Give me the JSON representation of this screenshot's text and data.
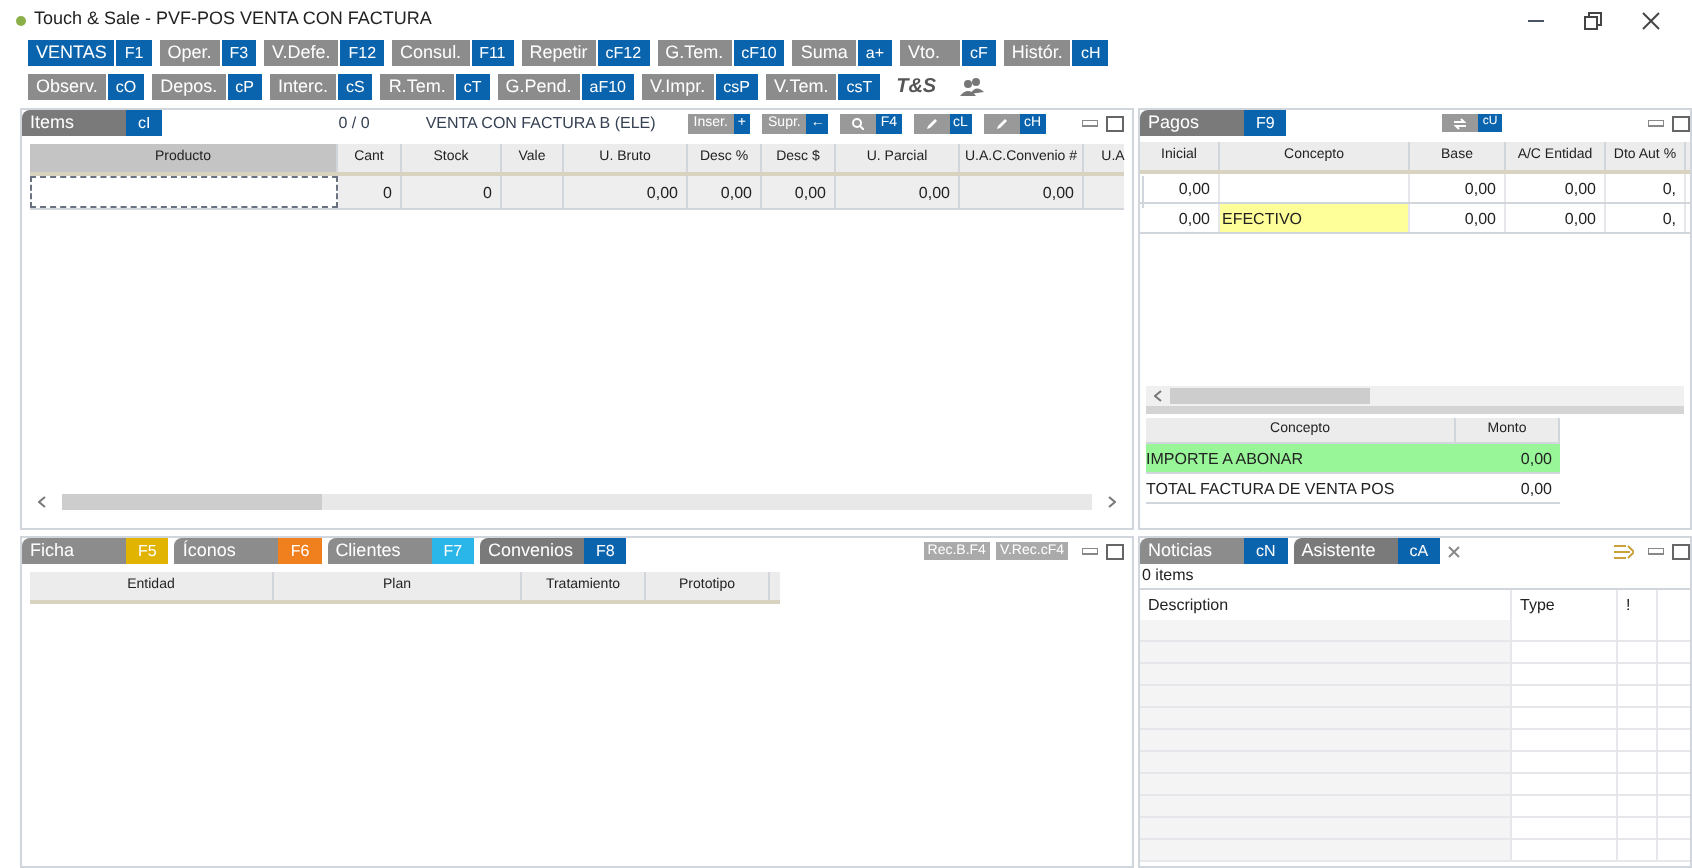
{
  "window": {
    "title": "Touch & Sale - PVF-POS VENTA CON FACTURA"
  },
  "toolbar": [
    [
      {
        "label": "VENTAS",
        "key": "F1",
        "selected": true
      },
      {
        "label": "Oper.",
        "key": "F3",
        "selected": false
      },
      {
        "label": "V.Defe.",
        "key": "F12",
        "selected": false
      },
      {
        "label": "Consul.",
        "key": "F11",
        "selected": false
      },
      {
        "label": "Repetir",
        "key": "cF12",
        "selected": false
      },
      {
        "label": "G.Tem.",
        "key": "cF10",
        "selected": false
      },
      {
        "label": "Suma",
        "key": "a+",
        "selected": false
      },
      {
        "label": "Vto.",
        "key": "cF",
        "selected": false
      },
      {
        "label": "Histór.",
        "key": "cH",
        "selected": false
      }
    ],
    [
      {
        "label": "Observ.",
        "key": "cO",
        "selected": false
      },
      {
        "label": "Depos.",
        "key": "cP",
        "selected": false
      },
      {
        "label": "Interc.",
        "key": "cS",
        "selected": false
      },
      {
        "label": "R.Tem.",
        "key": "cT",
        "selected": false
      },
      {
        "label": "G.Pend.",
        "key": "aF10",
        "selected": false
      },
      {
        "label": "V.Impr.",
        "key": "csP",
        "selected": false
      },
      {
        "label": "V.Tem.",
        "key": "csT",
        "selected": false
      }
    ]
  ],
  "logo": "T&S",
  "items_panel": {
    "tab": {
      "label": "Items",
      "key": "cI"
    },
    "counter": "0 / 0",
    "title": "VENTA CON FACTURA B (ELE)",
    "actions": [
      {
        "kind": "text",
        "label": "Inser.",
        "key": "+"
      },
      {
        "kind": "text",
        "label": "Supr.",
        "key": "←"
      },
      {
        "kind": "search",
        "key": "F4"
      },
      {
        "kind": "tool",
        "key": "cL"
      },
      {
        "kind": "tool",
        "key": "cH"
      }
    ],
    "columns": [
      "Producto",
      "Cant",
      "Stock",
      "Vale",
      "U. Bruto",
      "Desc %",
      "Desc $",
      "U. Parcial",
      "U.A.C.Convenio #",
      "U.A"
    ],
    "rows": [
      [
        "",
        "0",
        "0",
        "",
        "0,00",
        "0,00",
        "0,00",
        "0,00",
        "0,00",
        ""
      ]
    ]
  },
  "pagos_panel": {
    "tab": {
      "label": "Pagos",
      "key": "F9"
    },
    "action_key": "cU",
    "columns": [
      "Inicial",
      "Concepto",
      "Base",
      "A/C Entidad",
      "Dto Aut %"
    ],
    "rows": [
      {
        "cells": [
          "0,00",
          "",
          "0,00",
          "0,00",
          "0,"
        ],
        "highlighted": false
      },
      {
        "cells": [
          "0,00",
          "EFECTIVO",
          "0,00",
          "0,00",
          "0,"
        ],
        "highlighted": true
      }
    ],
    "summary": {
      "columns": [
        "Concepto",
        "Monto"
      ],
      "rows": [
        {
          "concepto": "IMPORTE A ABONAR",
          "monto": "0,00",
          "highlighted": true
        },
        {
          "concepto": "TOTAL FACTURA DE VENTA POS",
          "monto": "0,00",
          "highlighted": false
        }
      ]
    }
  },
  "bottom_left": {
    "tabs": [
      {
        "label": "Ficha",
        "key": "F5",
        "color": "#e0b400",
        "selected": false
      },
      {
        "label": "Íconos",
        "key": "F6",
        "color": "#f07f1e",
        "selected": false
      },
      {
        "label": "Clientes",
        "key": "F7",
        "color": "#2ab6e8",
        "selected": false
      },
      {
        "label": "Convenios",
        "key": "F8",
        "color": "#0a64ad",
        "selected": true
      }
    ],
    "buttons": [
      "Rec.B.F4",
      "V.Rec.cF4"
    ],
    "columns": [
      "Entidad",
      "Plan",
      "Tratamiento",
      "Prototipo"
    ]
  },
  "bottom_right": {
    "tabs": [
      {
        "label": "Noticias",
        "key": "cN",
        "selected": false,
        "closable": false
      },
      {
        "label": "Asistente",
        "key": "cA",
        "selected": true,
        "closable": true
      }
    ],
    "count": "0 items",
    "columns": [
      "Description",
      "Type",
      "!"
    ]
  }
}
